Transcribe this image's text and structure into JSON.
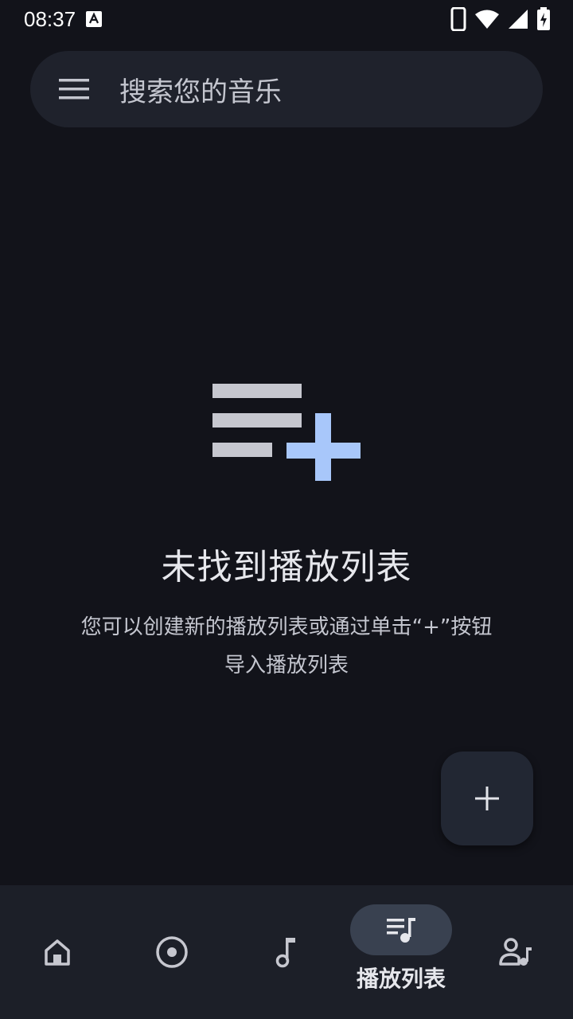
{
  "status_bar": {
    "time": "08:37"
  },
  "search": {
    "placeholder": "搜索您的音乐"
  },
  "empty_state": {
    "title": "未找到播放列表",
    "description": "您可以创建新的播放列表或通过单击“+”按钮导入播放列表"
  },
  "bottom_nav": {
    "items": [
      {
        "icon": "home-icon",
        "label": ""
      },
      {
        "icon": "album-icon",
        "label": ""
      },
      {
        "icon": "music-note-icon",
        "label": ""
      },
      {
        "icon": "playlist-icon",
        "label": "播放列表",
        "active": true
      },
      {
        "icon": "artist-icon",
        "label": ""
      }
    ]
  },
  "colors": {
    "background": "#12131a",
    "surface": "#1f222c",
    "nav_background": "#1c1f28",
    "active_pill": "#394150",
    "accent_blue": "#a8c7fa"
  }
}
